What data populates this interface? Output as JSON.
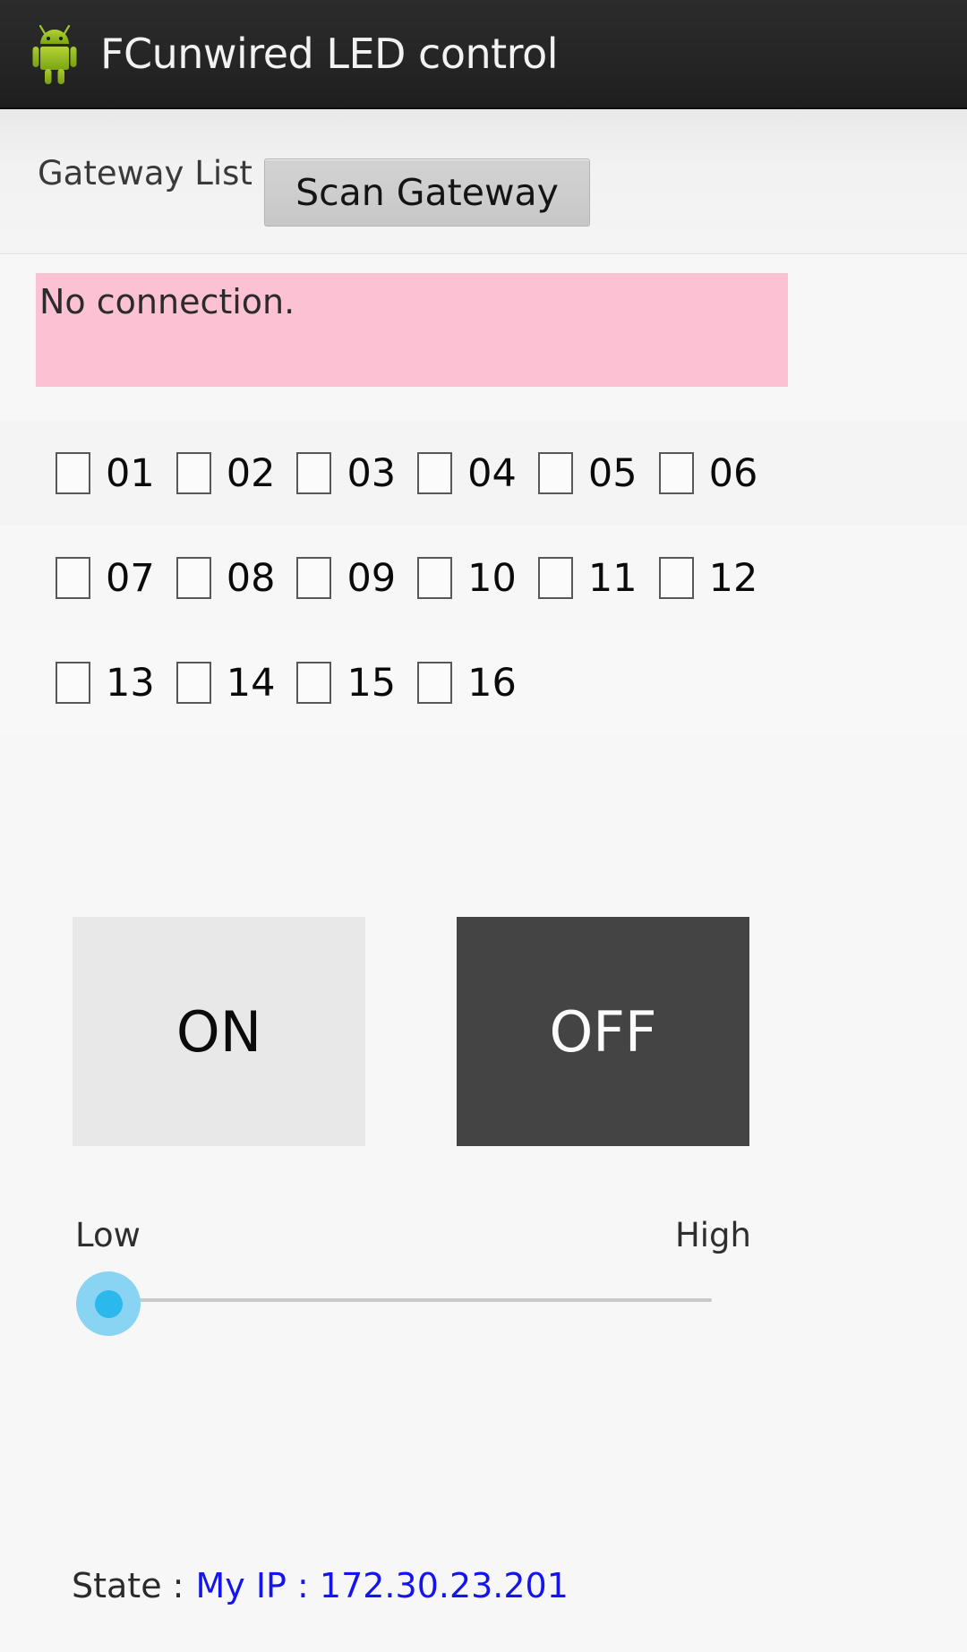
{
  "titlebar": {
    "icon": "android-robot-icon",
    "title": "FCunwired LED control"
  },
  "gateway": {
    "list_label": "Gateway List",
    "scan_button": "Scan Gateway"
  },
  "status": {
    "message": "No connection.",
    "background_color": "#fcc2d4"
  },
  "channels": {
    "rows": [
      [
        {
          "label": "01",
          "checked": false
        },
        {
          "label": "02",
          "checked": false
        },
        {
          "label": "03",
          "checked": false
        },
        {
          "label": "04",
          "checked": false
        },
        {
          "label": "05",
          "checked": false
        },
        {
          "label": "06",
          "checked": false
        }
      ],
      [
        {
          "label": "07",
          "checked": false
        },
        {
          "label": "08",
          "checked": false
        },
        {
          "label": "09",
          "checked": false
        },
        {
          "label": "10",
          "checked": false
        },
        {
          "label": "11",
          "checked": false
        },
        {
          "label": "12",
          "checked": false
        }
      ],
      [
        {
          "label": "13",
          "checked": false
        },
        {
          "label": "14",
          "checked": false
        },
        {
          "label": "15",
          "checked": false
        },
        {
          "label": "16",
          "checked": false
        }
      ]
    ]
  },
  "power": {
    "on_label": "ON",
    "off_label": "OFF",
    "on_color": "#e8e8e8",
    "off_color": "#444444"
  },
  "brightness": {
    "low_label": "Low",
    "high_label": "High",
    "value_percent": 0,
    "thumb_color": "#2bb8ed",
    "halo_color": "#88d4f2"
  },
  "state": {
    "key": "State :",
    "value": "My IP : 172.30.23.201",
    "value_color": "#1414ee"
  }
}
